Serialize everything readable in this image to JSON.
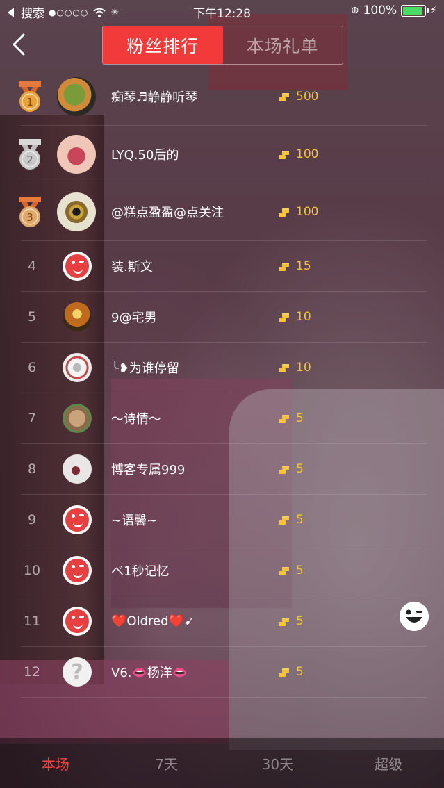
{
  "status_bar": {
    "carrier": "搜索",
    "time": "下午12:28",
    "battery": "100%",
    "battery_level": 1.0
  },
  "header": {
    "tabs": [
      {
        "label": "粉丝排行",
        "active": true
      },
      {
        "label": "本场礼单",
        "active": false
      }
    ]
  },
  "rankings": [
    {
      "rank": "1",
      "name": "痴琴♬静静听琴",
      "gifts": "500",
      "medal": "gold"
    },
    {
      "rank": "2",
      "name": "LYQ.50后的",
      "gifts": "100",
      "medal": "silver"
    },
    {
      "rank": "3",
      "name": "@糕点盈盈@点关注",
      "gifts": "100",
      "medal": "bronze"
    },
    {
      "rank": "4",
      "name": "装.斯文",
      "gifts": "15"
    },
    {
      "rank": "5",
      "name": "9@宅男",
      "gifts": "10"
    },
    {
      "rank": "6",
      "name": "╰❥为谁停留",
      "gifts": "10"
    },
    {
      "rank": "7",
      "name": "～诗情～",
      "gifts": "5"
    },
    {
      "rank": "8",
      "name": "博客专属999",
      "gifts": "5"
    },
    {
      "rank": "9",
      "name": "~语馨~",
      "gifts": "5"
    },
    {
      "rank": "10",
      "name": "ベ1秒记忆",
      "gifts": "5"
    },
    {
      "rank": "11",
      "name": "❤️Oldred❤️➹",
      "gifts": "5"
    },
    {
      "rank": "12",
      "name": "V6.👄杨洋👄",
      "gifts": "5"
    }
  ],
  "bottom_tabs": [
    {
      "label": "本场",
      "active": true
    },
    {
      "label": "7天",
      "active": false
    },
    {
      "label": "30天",
      "active": false
    },
    {
      "label": "超级",
      "active": false
    }
  ],
  "colors": {
    "accent": "#f23a3a",
    "gift": "#f5c23a",
    "gold": "#e9a23b",
    "silver": "#c9c9c9",
    "bronze": "#e0a86a"
  },
  "icons": {
    "back": "back-arrow-icon",
    "gift": "coin-stack-icon",
    "emoji": "wink-face-icon"
  }
}
